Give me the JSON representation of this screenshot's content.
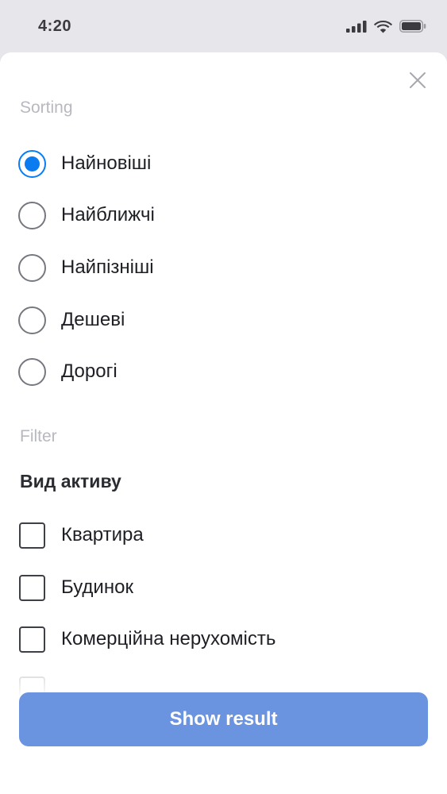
{
  "status_bar": {
    "time": "4:20"
  },
  "sorting": {
    "label": "Sorting",
    "options": [
      {
        "label": "Найновіші",
        "selected": true
      },
      {
        "label": "Найближчі",
        "selected": false
      },
      {
        "label": "Найпізніші",
        "selected": false
      },
      {
        "label": "Дешеві",
        "selected": false
      },
      {
        "label": "Дорогі",
        "selected": false
      }
    ]
  },
  "filter": {
    "label": "Filter",
    "group_title": "Вид активу",
    "options": [
      {
        "label": "Квартира",
        "checked": false
      },
      {
        "label": "Будинок",
        "checked": false
      },
      {
        "label": "Комерційна нерухомість",
        "checked": false
      }
    ]
  },
  "actions": {
    "show_result": "Show result"
  },
  "colors": {
    "accent": "#0a7cf0",
    "button": "#6a93e0",
    "muted": "#b7b9c0"
  },
  "icons": [
    "signal-icon",
    "wifi-icon",
    "battery-icon",
    "close-icon"
  ]
}
